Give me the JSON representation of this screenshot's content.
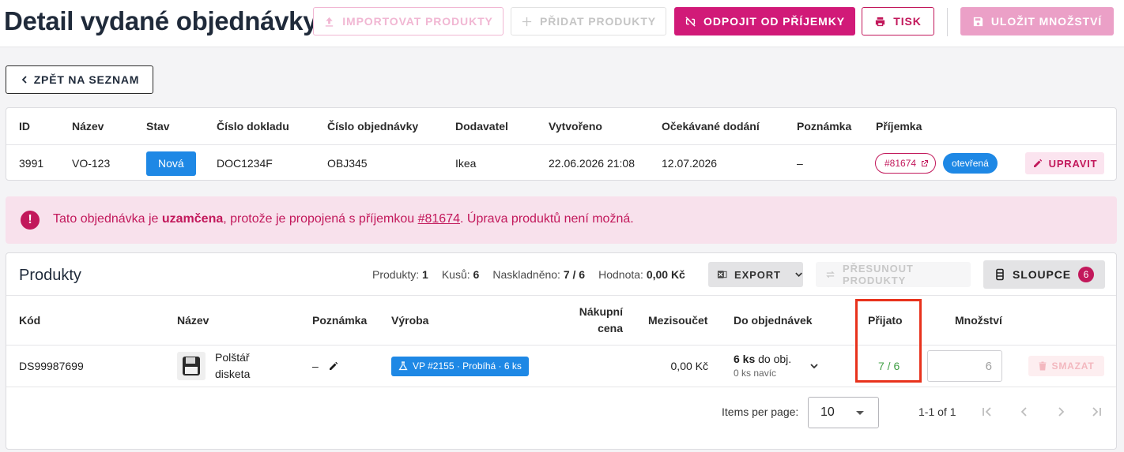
{
  "page": {
    "title": "Detail vydané objednávky"
  },
  "toolbar": {
    "import_label": "IMPORTOVAT PRODUKTY",
    "add_label": "PŘIDAT PRODUKTY",
    "unlink_label": "ODPOJIT OD PŘÍJEMKY",
    "print_label": "TISK",
    "save_label": "ULOŽIT MNOŽSTVÍ"
  },
  "back": {
    "label": "ZPĚT NA SEZNAM"
  },
  "info": {
    "headers": [
      "ID",
      "Název",
      "Stav",
      "Číslo dokladu",
      "Číslo objednávky",
      "Dodavatel",
      "Vytvořeno",
      "Očekávané dodání",
      "Poznámka",
      "Příjemka"
    ],
    "row": {
      "id": "3991",
      "name": "VO-123",
      "status": "Nová",
      "doc_number": "DOC1234F",
      "order_number": "OBJ345",
      "supplier": "Ikea",
      "created": "22.06.2026 21:08",
      "expected": "12.07.2026",
      "note": "–",
      "receipt_link": "#81674",
      "receipt_status": "otevřená"
    },
    "edit_label": "UPRAVIT"
  },
  "alert": {
    "part1": "Tato objednávka je ",
    "bold": "uzamčena",
    "part2": ", protože je propojená s příjemkou ",
    "link": "#81674",
    "part3": ". Úprava produktů není možná."
  },
  "products": {
    "title": "Produkty",
    "stats": [
      {
        "label": "Produkty:",
        "value": "1"
      },
      {
        "label": "Kusů:",
        "value": "6"
      },
      {
        "label": "Naskladněno:",
        "value": "7 / 6"
      },
      {
        "label": "Hodnota:",
        "value": "0,00 Kč"
      }
    ],
    "export_label": "EXPORT",
    "move_label": "PŘESUNOUT PRODUKTY",
    "columns_label": "SLOUPCE",
    "columns_count": "6",
    "headers": {
      "code": "Kód",
      "name": "Název",
      "note": "Poznámka",
      "production": "Výroba",
      "price_line1": "Nákupní",
      "price_line2": "cena",
      "subtotal": "Mezisoučet",
      "to_orders": "Do objednávek",
      "received": "Přijato",
      "quantity": "Množství"
    },
    "row": {
      "code": "DS99987699",
      "name_line1": "Polštář",
      "name_line2": "disketa",
      "note": "–",
      "production_chip": "VP #2155 · Probíhá · 6 ks",
      "subtotal": "0,00 Kč",
      "to_orders_bold": "6 ks",
      "to_orders_rest": " do obj.",
      "to_orders_sub": "0 ks navíc",
      "received": "7 / 6",
      "quantity": "6",
      "delete_label": "SMAZAT"
    }
  },
  "pager": {
    "items_label": "Items per page:",
    "page_size": "10",
    "range": "1-1 of 1"
  },
  "colors": {
    "brand": "#c2185b",
    "primary_button": "#d11a78",
    "blue": "#1e88e5",
    "received_green": "#43a047",
    "highlight": "#e8321c"
  },
  "icons": [
    "upload-icon",
    "plus-icon",
    "unlink-icon",
    "printer-icon",
    "save-icon",
    "chevron-left-icon",
    "external-link-icon",
    "pencil-icon",
    "alert-icon",
    "excel-icon",
    "chevron-down-icon",
    "swap-icon",
    "columns-icon",
    "flask-icon",
    "trash-icon",
    "first-page-icon",
    "prev-page-icon",
    "next-page-icon",
    "last-page-icon"
  ]
}
